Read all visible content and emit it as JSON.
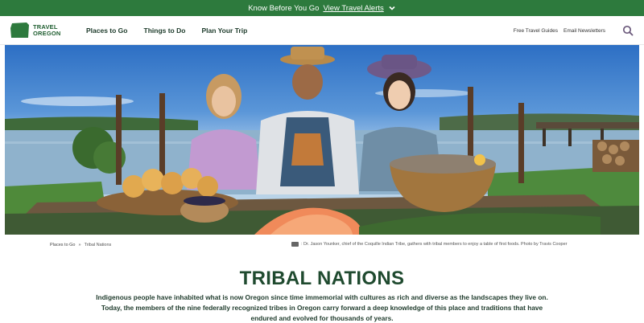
{
  "alert": {
    "text": "Know Before You Go",
    "link": "View Travel Alerts"
  },
  "brand": {
    "logo_line1": "TRAVEL",
    "logo_line2": "OREGON",
    "color": "#2d7a3d"
  },
  "nav": {
    "items": [
      "Places to Go",
      "Things to Do",
      "Plan Your Trip"
    ]
  },
  "utility": {
    "guides": "Free Travel Guides",
    "newsletters": "Email Newsletters"
  },
  "breadcrumb": {
    "parent": "Places to Go",
    "separator": "»",
    "current": "Tribal Nations"
  },
  "photo": {
    "caption": ": Dr. Jason Younker, chief of the Coquille Indian Tribe, gathers with tribal members to enjoy a table of first foods. Photo by Travis Cooper"
  },
  "page": {
    "title": "TRIBAL NATIONS",
    "intro": "Indigenous people have inhabited what is now Oregon since time immemorial with cultures as rich and diverse as the landscapes they live on. Today, the members of the nine federally recognized tribes in Oregon carry forward a deep knowledge of this place and traditions that have endured and evolved for thousands of years."
  },
  "icons": [
    "chevron-down-icon",
    "oregon-logo-icon",
    "search-icon",
    "camera-icon"
  ]
}
